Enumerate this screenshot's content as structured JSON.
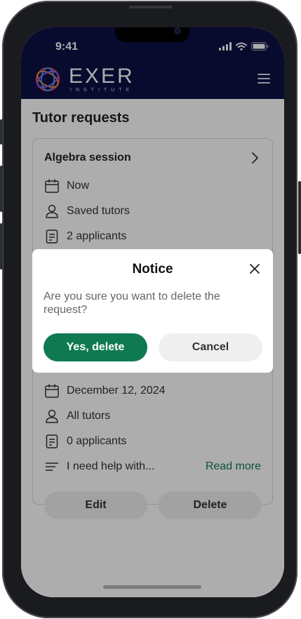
{
  "status_bar": {
    "time": "9:41"
  },
  "header": {
    "logo_main": "EXER",
    "logo_sub": "INSTITUTE"
  },
  "page": {
    "title": "Tutor requests"
  },
  "requests": [
    {
      "title": "Algebra session",
      "when": "Now",
      "tutors": "Saved tutors",
      "applicants": "2 applicants"
    },
    {
      "when": "December 12, 2024",
      "tutors": "All tutors",
      "applicants": "0 applicants",
      "description": "I need help with...",
      "read_more": "Read more",
      "edit_label": "Edit",
      "delete_label": "Delete"
    }
  ],
  "modal": {
    "title": "Notice",
    "message": "Are you sure you want to delete the request?",
    "confirm_label": "Yes, delete",
    "cancel_label": "Cancel"
  },
  "colors": {
    "header_bg": "#0c1045",
    "accent": "#0f7a52"
  }
}
